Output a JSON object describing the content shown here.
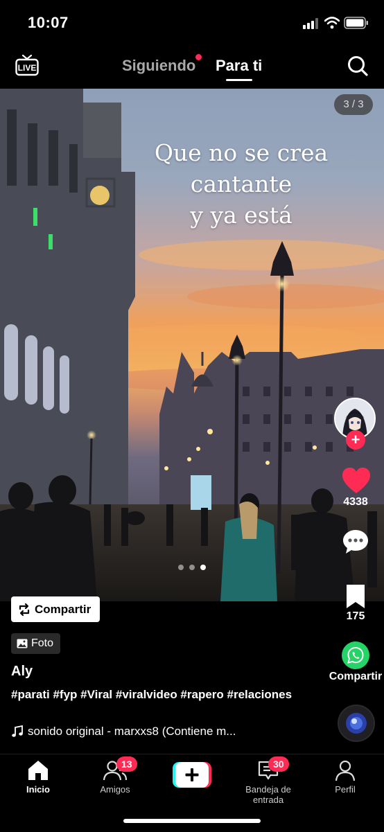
{
  "status_bar": {
    "time": "10:07"
  },
  "top_nav": {
    "following_label": "Siguiendo",
    "foryou_label": "Para ti",
    "live_label": "LIVE"
  },
  "post": {
    "photo_counter": "3 / 3",
    "overlay_text": "Que no se crea\ncantante\ny ya está",
    "carousel": {
      "total": 3,
      "active": 3
    },
    "repost_label": "Compartir",
    "photo_badge_label": "Foto",
    "author": "Aly",
    "caption": "#parati #fyp #Viral #viralvideo #rapero #relaciones",
    "sound": "sonido original - marxxs8 (Contiene m..."
  },
  "actions": {
    "like_count": "4338",
    "bookmark_count": "175",
    "share_label": "Compartir",
    "follow_symbol": "+"
  },
  "bottom_nav": {
    "home_label": "Inicio",
    "friends_label": "Amigos",
    "friends_badge": "13",
    "inbox_label": "Bandeja de entrada",
    "inbox_badge": "30",
    "profile_label": "Perfil"
  },
  "colors": {
    "accent": "#fe2c55",
    "whatsapp": "#25d366",
    "background": "#000000"
  },
  "icons": [
    "live-icon",
    "search-icon",
    "heart-icon",
    "comment-icon",
    "bookmark-icon",
    "whatsapp-icon",
    "repost-icon",
    "photo-icon",
    "music-note-icon",
    "home-icon",
    "friends-icon",
    "plus-icon",
    "inbox-icon",
    "profile-icon"
  ]
}
